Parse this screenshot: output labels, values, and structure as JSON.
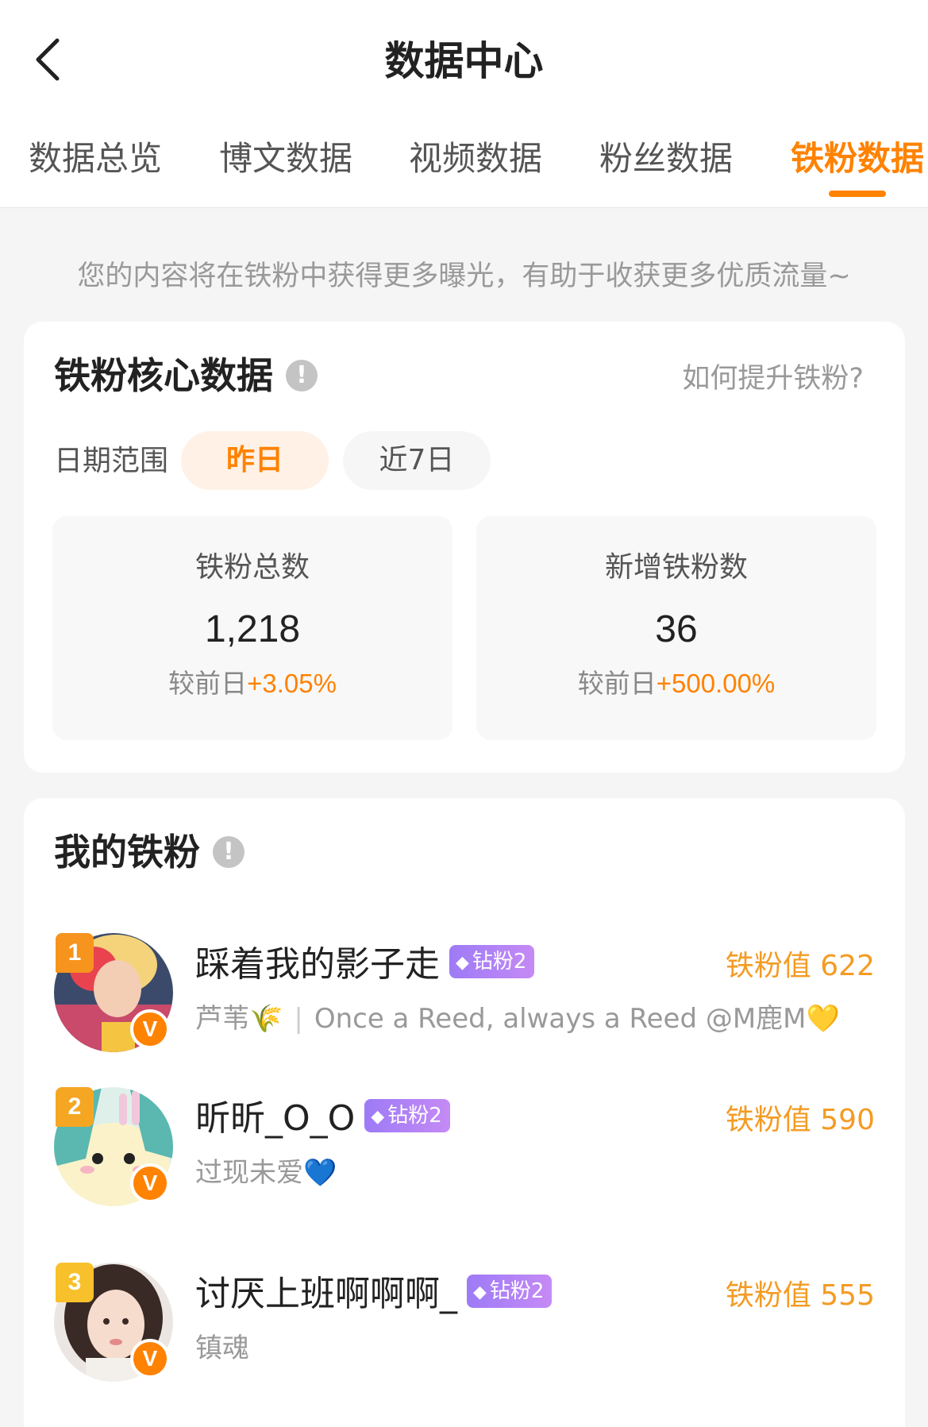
{
  "header": {
    "title": "数据中心",
    "tabs": [
      {
        "label": "数据总览"
      },
      {
        "label": "博文数据"
      },
      {
        "label": "视频数据"
      },
      {
        "label": "粉丝数据"
      },
      {
        "label": "铁粉数据"
      }
    ],
    "active_tab": "铁粉数据"
  },
  "notice": "您的内容将在铁粉中获得更多曝光，有助于收获更多优质流量~",
  "core": {
    "title": "铁粉核心数据",
    "info_symbol": "!",
    "how_link": "如何提升铁粉?",
    "range_label": "日期范围",
    "range_options": [
      "昨日",
      "近7日"
    ],
    "selected_range": "昨日",
    "stats": [
      {
        "label": "铁粉总数",
        "value": "1,218",
        "change_prefix": "较前日",
        "change": "+3.05%"
      },
      {
        "label": "新增铁粉数",
        "value": "36",
        "change_prefix": "较前日",
        "change": "+500.00%"
      }
    ]
  },
  "my_fans": {
    "title": "我的铁粉",
    "info_symbol": "!",
    "list": [
      {
        "rank": "1",
        "name": "踩着我的影子走",
        "tag": "钻粉2",
        "score": "铁粉值 622",
        "desc": "芦苇🌾",
        "desc2": "Once a Reed, always a Reed @M鹿M💛",
        "verified": "V"
      },
      {
        "rank": "2",
        "name": "昕昕_O_O",
        "tag": "钻粉2",
        "score": "铁粉值 590",
        "desc": "过现未爱💙",
        "desc2": "",
        "verified": "V"
      },
      {
        "rank": "3",
        "name": "讨厌上班啊啊啊_",
        "tag": "钻粉2",
        "score": "铁粉值 555",
        "desc": "镇魂",
        "desc2": "",
        "verified": "V"
      }
    ]
  },
  "colors": {
    "accent": "#ff8200",
    "score": "#f49b23",
    "tag_gradient_start": "#9d7bf6",
    "tag_gradient_end": "#c58af5",
    "rank1": "#f7941d",
    "rank2": "#f5a623",
    "rank3": "#f8c12b"
  }
}
